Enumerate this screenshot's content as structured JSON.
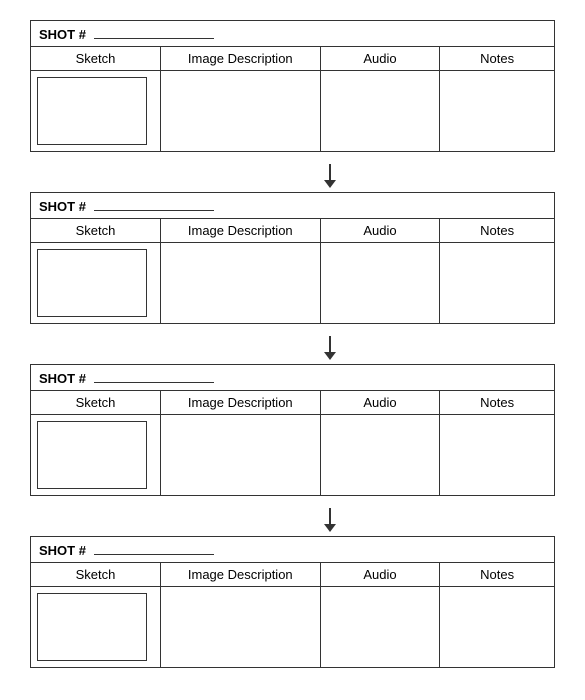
{
  "shots": [
    {
      "id": "shot-1",
      "label": "SHOT #",
      "columns": {
        "sketch": "Sketch",
        "image_description": "Image Description",
        "audio": "Audio",
        "notes": "Notes"
      }
    },
    {
      "id": "shot-2",
      "label": "SHOT #",
      "columns": {
        "sketch": "Sketch",
        "image_description": "Image Description",
        "audio": "Audio",
        "notes": "Notes"
      }
    },
    {
      "id": "shot-3",
      "label": "SHOT #",
      "columns": {
        "sketch": "Sketch",
        "image_description": "Image Description",
        "audio": "Audio",
        "notes": "Notes"
      }
    },
    {
      "id": "shot-4",
      "label": "SHOT #",
      "columns": {
        "sketch": "Sketch",
        "image_description": "Image Description",
        "audio": "Audio",
        "notes": "Notes"
      }
    }
  ],
  "arrow": {
    "aria_label": "next arrow"
  }
}
